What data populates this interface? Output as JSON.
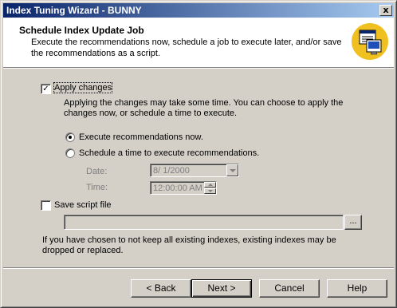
{
  "window": {
    "title": "Index Tuning Wizard - BUNNY",
    "close_glyph": "x"
  },
  "header": {
    "title": "Schedule Index Update Job",
    "description": "Execute the recommendations now, schedule a job to execute later, and/or save the recommendations as a script."
  },
  "apply": {
    "label": "Apply changes",
    "checked": true,
    "help": "Applying the changes may take some time. You can choose to apply the changes now, or schedule a time to execute."
  },
  "options": {
    "execute_now": {
      "label": "Execute recommendations now.",
      "selected": true
    },
    "schedule": {
      "label": "Schedule a time to execute recommendations.",
      "selected": false
    }
  },
  "schedule": {
    "date_label": "Date:",
    "date_value": "8/  1/2000",
    "time_label": "Time:",
    "time_value": "12:00:00 AM"
  },
  "script": {
    "label": "Save script file",
    "checked": false,
    "path_value": "",
    "browse_label": "..."
  },
  "warning": "If you have chosen to not keep all existing indexes, existing indexes may be dropped or replaced.",
  "buttons": {
    "back": "< Back",
    "next": "Next >",
    "cancel": "Cancel",
    "help": "Help"
  }
}
